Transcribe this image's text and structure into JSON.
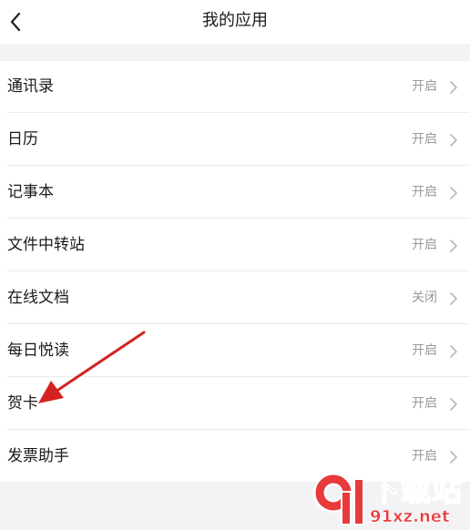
{
  "header": {
    "title": "我的应用",
    "back_icon": "chevron-left-icon"
  },
  "apps": [
    {
      "name": "通讯录",
      "status": "开启"
    },
    {
      "name": "日历",
      "status": "开启"
    },
    {
      "name": "记事本",
      "status": "开启"
    },
    {
      "name": "文件中转站",
      "status": "开启"
    },
    {
      "name": "在线文档",
      "status": "关闭"
    },
    {
      "name": "每日悦读",
      "status": "开启"
    },
    {
      "name": "贺卡",
      "status": "开启"
    },
    {
      "name": "发票助手",
      "status": "开启"
    }
  ],
  "annotation": {
    "color": "#d42222",
    "points_to": "贺卡"
  },
  "watermark": {
    "text": "下载站",
    "domain": "91xz.net",
    "color": "#e83a3a"
  }
}
